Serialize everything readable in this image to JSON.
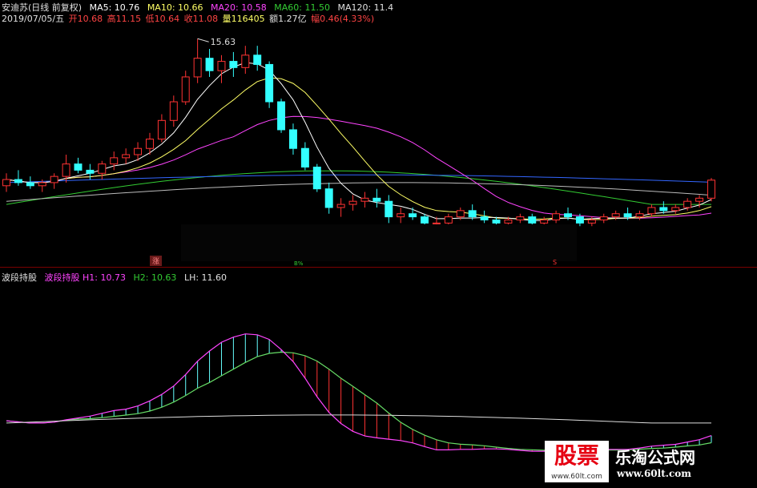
{
  "header": {
    "stock_name": "安迪苏(日线 前复权)",
    "ma5": "MA5: 10.76",
    "ma10": "MA10: 10.66",
    "ma20": "MA20: 10.58",
    "ma60": "MA60: 11.50",
    "ma120": "MA120: 11.4",
    "date": "2019/07/05/五",
    "open": "开10.68",
    "high": "高11.15",
    "low": "低10.64",
    "close": "收11.08",
    "volume": "量116405",
    "amount": "额1.27亿",
    "change": "幅0.46(4.33%)"
  },
  "main_chart": {
    "high_label": "15.63",
    "tag_zhang": "涨",
    "tag_green": "B%",
    "tag_s": "S"
  },
  "indicator": {
    "name": "波段持股",
    "name2": "波段持股",
    "h1": "H1: 10.73",
    "h2": "H2: 10.63",
    "lh": "LH: 11.60"
  },
  "watermark": {
    "brand1": "股票",
    "brand1_sub": "www.60lt.com",
    "brand2": "乐淘公式网",
    "url": "www.60lt.com"
  },
  "colors": {
    "ma5": "#ffffff",
    "ma10": "#ffff66",
    "ma20": "#ff44ff",
    "ma60": "#33cc33",
    "ma120": "#3366ff",
    "up": "#ff3333",
    "down": "#33ffff"
  },
  "chart_data": {
    "type": "candlestick",
    "candles": [
      [
        10.9,
        11.3,
        10.7,
        11.1
      ],
      [
        11.1,
        11.4,
        10.9,
        11.0
      ],
      [
        11.0,
        11.2,
        10.8,
        10.9
      ],
      [
        10.9,
        11.1,
        10.7,
        11.0
      ],
      [
        11.0,
        11.3,
        10.8,
        11.2
      ],
      [
        11.2,
        11.9,
        11.0,
        11.6
      ],
      [
        11.6,
        11.8,
        11.3,
        11.4
      ],
      [
        11.4,
        11.6,
        11.1,
        11.3
      ],
      [
        11.3,
        11.7,
        11.1,
        11.6
      ],
      [
        11.6,
        12.0,
        11.4,
        11.8
      ],
      [
        11.8,
        12.1,
        11.6,
        11.9
      ],
      [
        11.9,
        12.3,
        11.7,
        12.1
      ],
      [
        12.1,
        12.6,
        11.9,
        12.4
      ],
      [
        12.4,
        13.2,
        12.3,
        13.0
      ],
      [
        13.0,
        13.8,
        12.8,
        13.6
      ],
      [
        13.6,
        14.6,
        13.5,
        14.4
      ],
      [
        14.4,
        15.63,
        14.2,
        15.0
      ],
      [
        15.0,
        15.3,
        14.4,
        14.6
      ],
      [
        14.6,
        15.1,
        14.2,
        14.9
      ],
      [
        14.9,
        15.2,
        14.4,
        14.7
      ],
      [
        14.7,
        15.4,
        14.5,
        15.1
      ],
      [
        15.1,
        15.4,
        14.6,
        14.8
      ],
      [
        14.8,
        14.9,
        13.4,
        13.6
      ],
      [
        13.6,
        13.7,
        12.6,
        12.7
      ],
      [
        12.7,
        12.9,
        11.9,
        12.1
      ],
      [
        12.1,
        12.3,
        11.4,
        11.5
      ],
      [
        11.5,
        11.6,
        10.7,
        10.8
      ],
      [
        10.8,
        11.0,
        10.0,
        10.2
      ],
      [
        10.2,
        10.5,
        9.9,
        10.3
      ],
      [
        10.3,
        10.6,
        10.1,
        10.4
      ],
      [
        10.4,
        10.7,
        10.2,
        10.5
      ],
      [
        10.5,
        10.8,
        10.2,
        10.4
      ],
      [
        10.4,
        10.6,
        9.7,
        9.9
      ],
      [
        9.9,
        10.2,
        9.7,
        10.0
      ],
      [
        10.0,
        10.2,
        9.8,
        9.9
      ],
      [
        9.9,
        10.0,
        9.6,
        9.7
      ],
      [
        9.7,
        9.9,
        9.6,
        9.7
      ],
      [
        9.7,
        10.0,
        9.6,
        9.9
      ],
      [
        9.9,
        10.2,
        9.8,
        10.1
      ],
      [
        10.1,
        10.3,
        9.8,
        9.9
      ],
      [
        9.9,
        10.1,
        9.7,
        9.8
      ],
      [
        9.8,
        9.9,
        9.6,
        9.7
      ],
      [
        9.7,
        9.9,
        9.6,
        9.8
      ],
      [
        9.8,
        10.0,
        9.7,
        9.9
      ],
      [
        9.9,
        10.0,
        9.6,
        9.7
      ],
      [
        9.7,
        9.9,
        9.6,
        9.8
      ],
      [
        9.8,
        10.1,
        9.7,
        10.0
      ],
      [
        10.0,
        10.2,
        9.8,
        9.9
      ],
      [
        9.9,
        10.0,
        9.6,
        9.7
      ],
      [
        9.7,
        9.9,
        9.6,
        9.8
      ],
      [
        9.8,
        10.0,
        9.7,
        9.9
      ],
      [
        9.9,
        10.1,
        9.8,
        10.0
      ],
      [
        10.0,
        10.2,
        9.8,
        9.9
      ],
      [
        9.9,
        10.1,
        9.8,
        10.0
      ],
      [
        10.0,
        10.3,
        9.9,
        10.2
      ],
      [
        10.2,
        10.4,
        10.0,
        10.1
      ],
      [
        10.1,
        10.3,
        10.0,
        10.2
      ],
      [
        10.2,
        10.5,
        10.1,
        10.4
      ],
      [
        10.4,
        10.6,
        10.2,
        10.5
      ],
      [
        10.5,
        11.15,
        10.4,
        11.08
      ]
    ],
    "ylim": [
      9.4,
      16.1
    ]
  }
}
